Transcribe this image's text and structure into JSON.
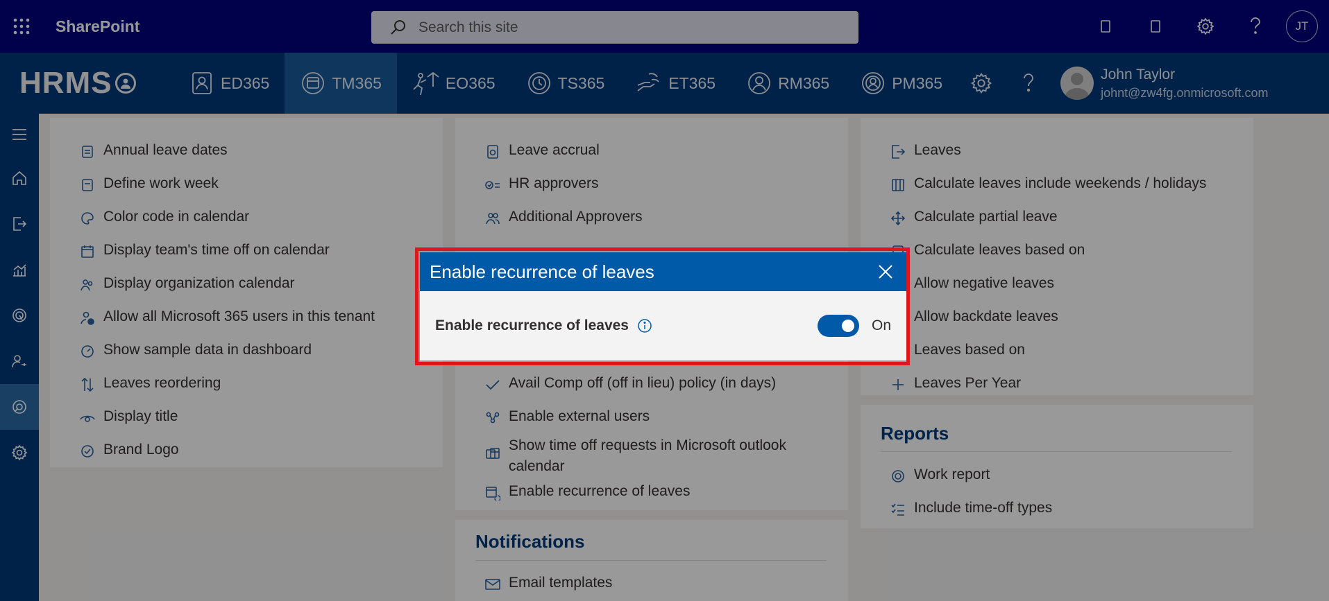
{
  "suitebar": {
    "app_name": "SharePoint",
    "search_placeholder": "Search this site",
    "avatar_initials": "JT"
  },
  "appnav": {
    "logo": "HRMS",
    "items": [
      {
        "label": "ED365"
      },
      {
        "label": "TM365"
      },
      {
        "label": "EO365"
      },
      {
        "label": "TS365"
      },
      {
        "label": "ET365"
      },
      {
        "label": "RM365"
      },
      {
        "label": "PM365"
      }
    ],
    "active_item": "TM365",
    "user": {
      "name": "John Taylor",
      "email": "johnt@zw4fg.onmicrosoft.com"
    }
  },
  "col1": {
    "items": [
      "Annual leave dates",
      "Define work week",
      "Color code in calendar",
      "Display team's time off on calendar",
      "Display organization calendar",
      "Allow all Microsoft 365 users in this tenant",
      "Show sample data in dashboard",
      "Leaves reordering",
      "Display title",
      "Brand Logo"
    ]
  },
  "col2": {
    "items": [
      "Leave accrual",
      "HR approvers",
      "Additional Approvers",
      "Avail Comp off (off in lieu) policy (in days)",
      "Enable external users",
      "Show time off requests in Microsoft outlook calendar",
      "Enable recurrence of leaves"
    ],
    "notifications_title": "Notifications",
    "notifications_items": [
      "Email templates"
    ]
  },
  "col3": {
    "items": [
      "Leaves",
      "Calculate leaves include weekends / holidays",
      "Calculate partial leave",
      "Calculate leaves based on",
      "Allow negative leaves",
      "Allow backdate leaves",
      "Leaves based on",
      "Leaves Per Year"
    ],
    "reports_title": "Reports",
    "reports_items": [
      "Work report",
      "Include time-off types"
    ]
  },
  "dialog": {
    "title": "Enable recurrence of leaves",
    "field_label": "Enable recurrence of leaves",
    "toggle_state": "On",
    "toggle_on": true
  },
  "colors": {
    "suitebar": "#00007d",
    "appnav": "#003a7a",
    "dialog_header": "#005aa8",
    "highlight_outline": "#e0161e"
  }
}
